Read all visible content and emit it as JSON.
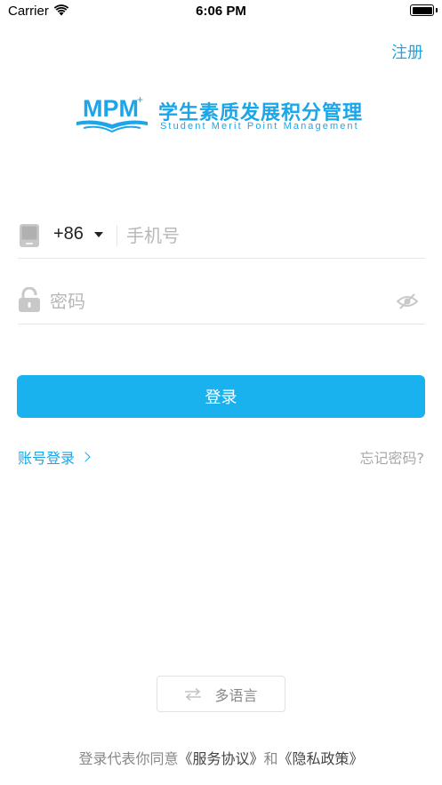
{
  "status_bar": {
    "carrier": "Carrier",
    "time": "6:06 PM"
  },
  "header": {
    "register_label": "注册"
  },
  "logo": {
    "mark_text": "MPM",
    "mark_plus": "+",
    "title": "学生素质发展积分管理",
    "subtitle": "Student Merit Point Management"
  },
  "form": {
    "country_code": "+86",
    "phone_placeholder": "手机号",
    "password_placeholder": "密码",
    "login_label": "登录",
    "account_login_label": "账号登录",
    "forgot_label": "忘记密码?"
  },
  "footer": {
    "language_label": "多语言",
    "agreement_prefix": "登录代表你同意",
    "service_link": "《服务协议》",
    "and": "和",
    "privacy_link": "《隐私政策》"
  },
  "colors": {
    "accent": "#1ab2ee",
    "link": "#1aa6e8",
    "muted": "#a8a8a8"
  }
}
